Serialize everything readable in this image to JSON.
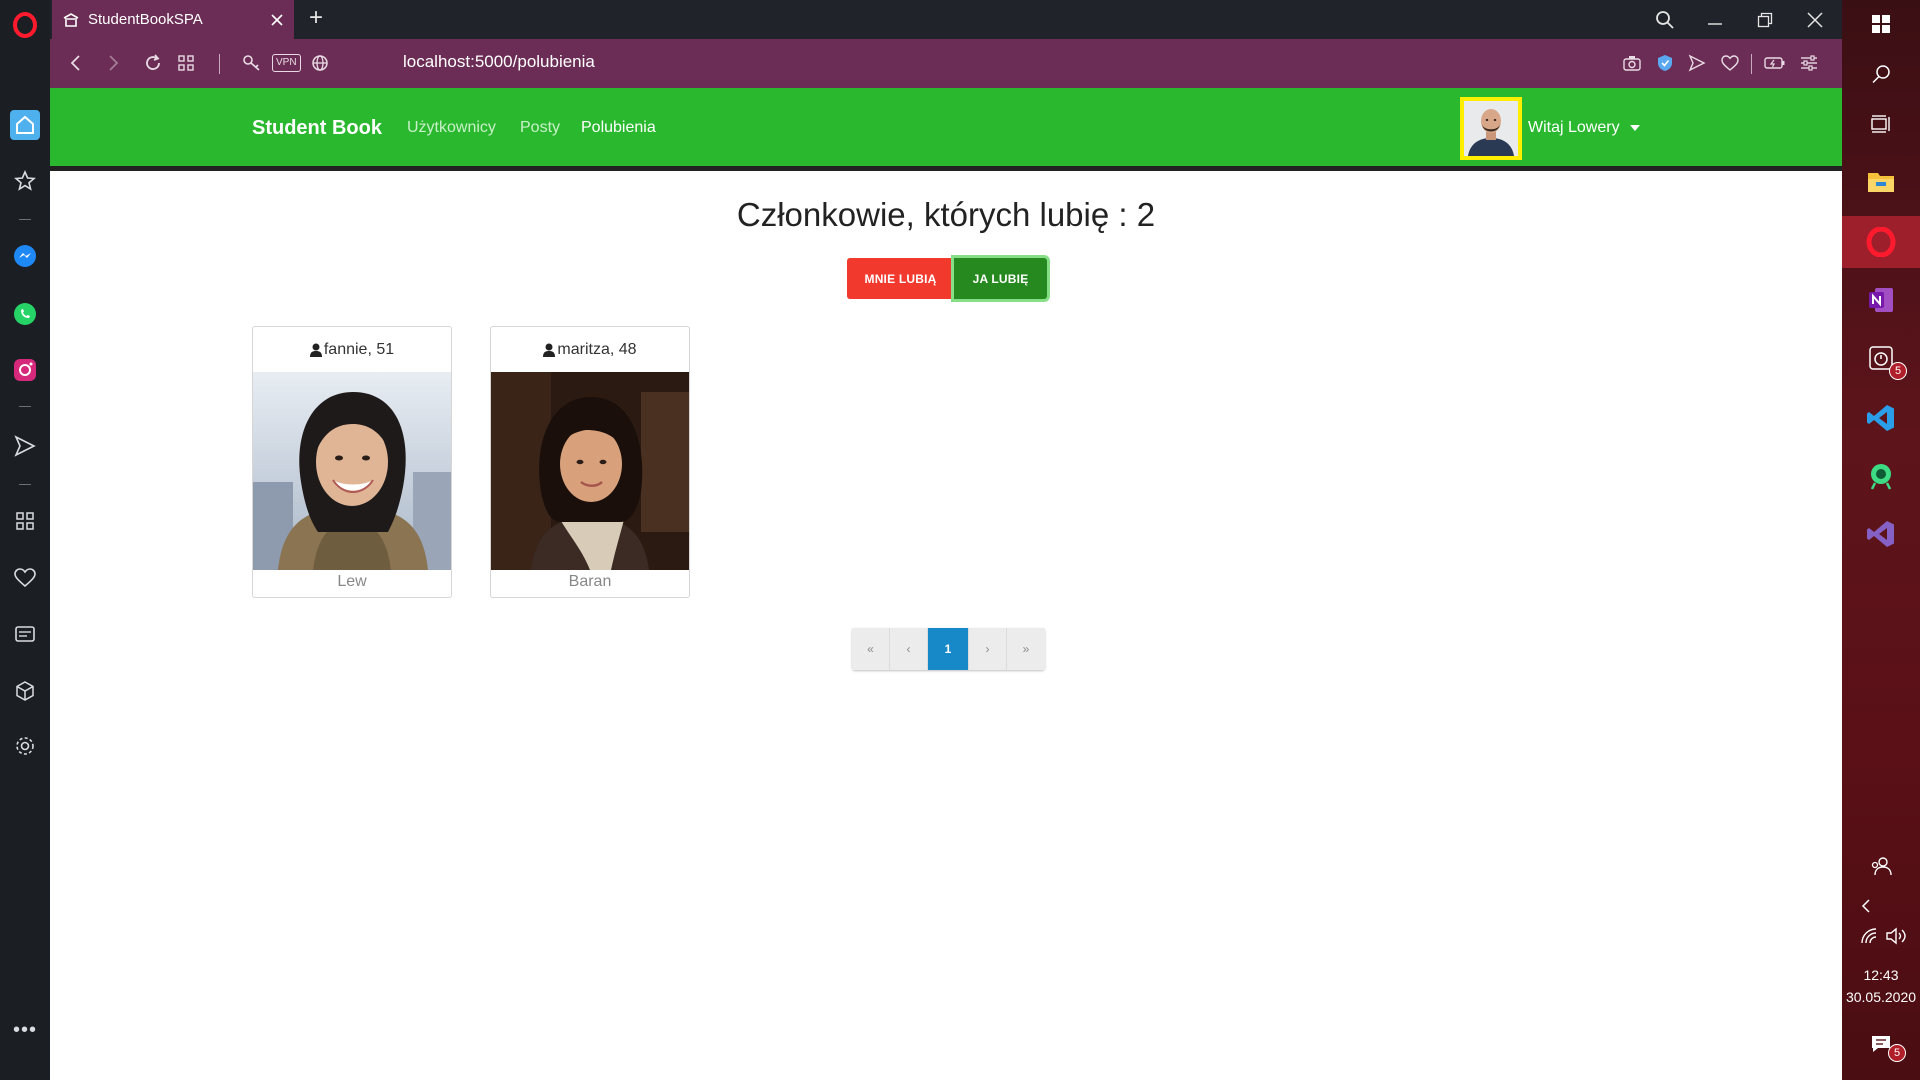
{
  "browser": {
    "tab_title": "StudentBookSPA",
    "url": "localhost:5000/polubienia",
    "vpn_label": "VPN"
  },
  "navbar": {
    "brand": "Student Book",
    "links": [
      {
        "label": "Użytkownicy",
        "active": false
      },
      {
        "label": "Posty",
        "active": false
      },
      {
        "label": "Polubienia",
        "active": true
      }
    ],
    "user_greeting": "Witaj Lowery"
  },
  "main": {
    "heading": "Członkowie, których lubię : 2",
    "filter_buttons": {
      "liked_by": "MNIE LUBIĄ",
      "i_like": "JA LUBIĘ"
    },
    "members": [
      {
        "header": "fannie, 51",
        "city": "Lew"
      },
      {
        "header": "maritza, 48",
        "city": "Baran"
      }
    ],
    "pagination": {
      "first": "«",
      "prev": "‹",
      "current": "1",
      "next": "›",
      "last": "»"
    }
  },
  "taskbar": {
    "badge_count": "5",
    "notif_count": "5",
    "time": "12:43",
    "date": "30.05.2020"
  },
  "colors": {
    "navbar_green": "#2ab82f",
    "browser_purple": "#6b2d55",
    "btn_red": "#f2392e",
    "btn_green": "#25891f",
    "page_active": "#1789c9"
  }
}
